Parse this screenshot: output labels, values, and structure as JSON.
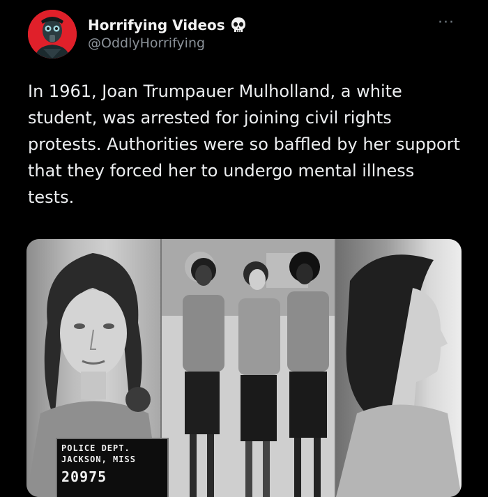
{
  "author": {
    "display_name": "Horrifying Videos",
    "handle": "@OddlyHorrifying",
    "name_badge_icon": "skull-icon",
    "avatar_icon": "gas-mask-figure-icon",
    "avatar_bg": "#e0202a"
  },
  "menu": {
    "icon": "more-options-icon",
    "glyph": "···"
  },
  "tweet": {
    "text": "In 1961, Joan Trumpauer Mulholland, a white student, was arrested for joining civil rights protests. Authorities were so baffled by her support that they forced her to undergo mental illness tests."
  },
  "media": {
    "placard": {
      "line1": "POLICE  DEPT.",
      "line2": "JACKSON, MISS",
      "number": "20975"
    }
  }
}
